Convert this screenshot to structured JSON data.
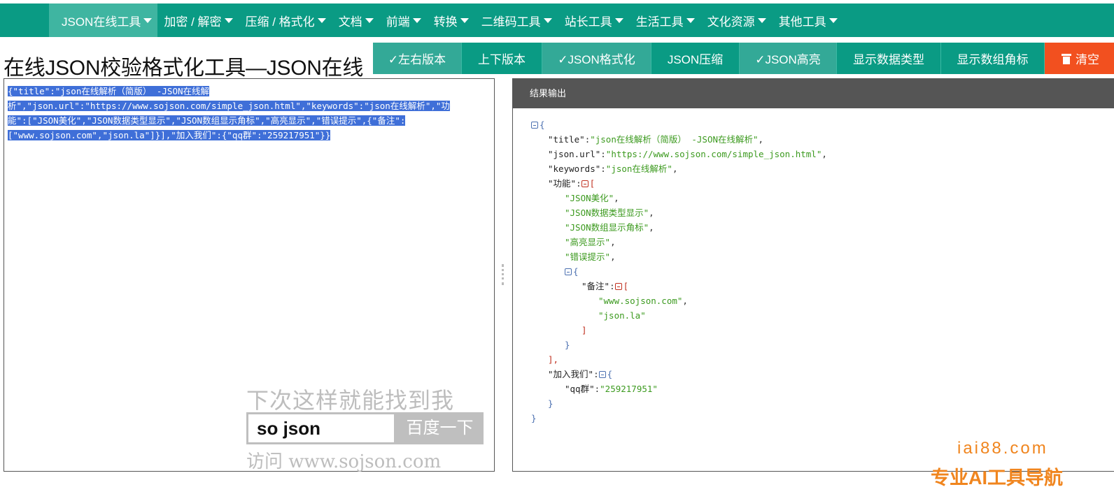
{
  "nav": {
    "items": [
      {
        "label": "JSON在线工具"
      },
      {
        "label": "加密 / 解密"
      },
      {
        "label": "压缩 / 格式化"
      },
      {
        "label": "文档"
      },
      {
        "label": "前端"
      },
      {
        "label": "转换"
      },
      {
        "label": "二维码工具"
      },
      {
        "label": "站长工具"
      },
      {
        "label": "生活工具"
      },
      {
        "label": "文化资源"
      },
      {
        "label": "其他工具"
      }
    ]
  },
  "page": {
    "title": "在线JSON校验格式化工具—JSON在线"
  },
  "toolbar": {
    "left_right": "✓左右版本",
    "top_bottom": "上下版本",
    "format": "✓JSON格式化",
    "compress": "JSON压缩",
    "highlight": "✓JSON高亮",
    "show_types": "显示数据类型",
    "show_index": "显示数组角标",
    "clear": "清空"
  },
  "editor": {
    "raw_lines": [
      "{\"title\":\"json在线解析（简版） -JSON在线解",
      "析\",\"json.url\":\"https://www.sojson.com/simple_json.html\",\"keywords\":\"json在线解析\",\"功",
      "能\":[\"JSON美化\",\"JSON数据类型显示\",\"JSON数组显示角标\",\"高亮显示\",\"错误提示\",{\"备注\":",
      "[\"www.sojson.com\",\"json.la\"]}],\"加入我们\":{\"qq群\":\"259217951\"}}"
    ]
  },
  "watermark": {
    "top": "下次这样就能找到我",
    "search_text": "so json",
    "search_button": "百度一下",
    "bottom": "访问 www.sojson.com"
  },
  "result": {
    "header": "结果输出",
    "brace_open": "{",
    "brace_close": "}",
    "bracket_open": "[",
    "bracket_close": "]",
    "bracket_close_comma": "],",
    "colon": ":",
    "comma": ",",
    "title_key": "\"title\"",
    "title_val": "\"json在线解析（简版） -JSON在线解析\"",
    "url_key": "\"json.url\"",
    "url_val": "\"https://www.sojson.com/simple_json.html\"",
    "keywords_key": "\"keywords\"",
    "keywords_val": "\"json在线解析\"",
    "features_key": "\"功能\"",
    "feature_items": [
      "\"JSON美化\"",
      "\"JSON数据类型显示\"",
      "\"JSON数组显示角标\"",
      "\"高亮显示\"",
      "\"错误提示\""
    ],
    "note_key": "\"备注\"",
    "note_items": [
      "\"www.sojson.com\"",
      "\"json.la\""
    ],
    "join_key": "\"加入我们\"",
    "qq_key": "\"qq群\"",
    "qq_val": "\"259217951\""
  },
  "brand": {
    "domain": "iai88.com",
    "slogan": "专业AI工具导航"
  }
}
